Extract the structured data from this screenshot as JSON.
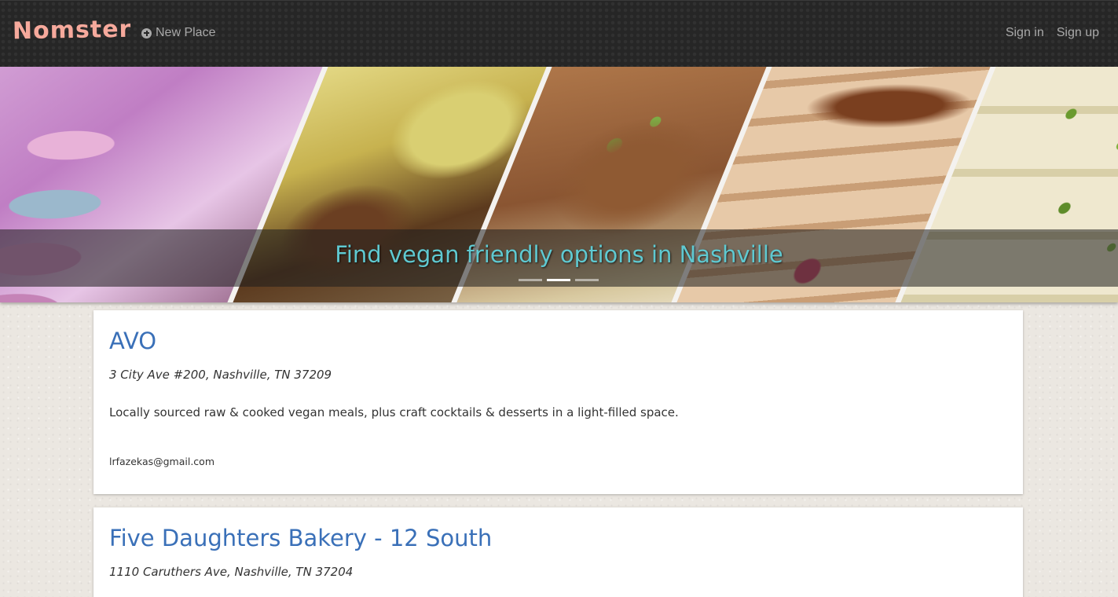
{
  "navbar": {
    "brand": "Nomster",
    "new_place_label": "New Place",
    "sign_in_label": "Sign in",
    "sign_up_label": "Sign up",
    "brand_color": "#f6a99c"
  },
  "hero": {
    "caption": "Find vegan friendly options in Nashville",
    "active_slide": 2,
    "slide_count": 3
  },
  "places": [
    {
      "name": "AVO",
      "address": "3 City Ave #200, Nashville, TN 37209",
      "description": "Locally sourced raw & cooked vegan meals, plus craft cocktails & desserts in a light-filled space.",
      "user": "lrfazekas@gmail.com"
    },
    {
      "name": "Five Daughters Bakery - 12 South",
      "address": "1110 Caruthers Ave, Nashville, TN 37204"
    }
  ]
}
